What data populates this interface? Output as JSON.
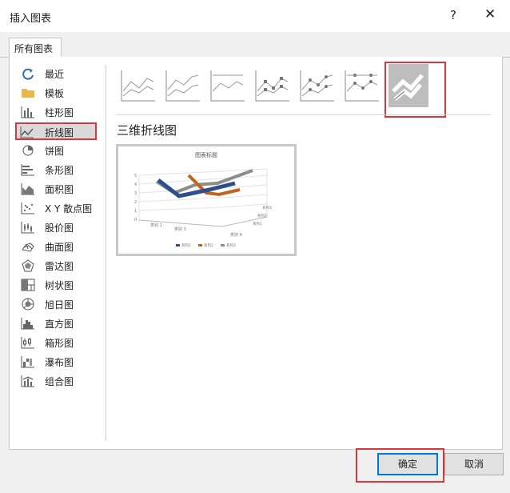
{
  "dialog": {
    "title": "插入图表",
    "help": "?",
    "close": "✕"
  },
  "tabs": [
    {
      "label": "所有图表"
    }
  ],
  "sidebar": {
    "items": [
      {
        "label": "最近",
        "icon": "recent-icon"
      },
      {
        "label": "模板",
        "icon": "folder-icon"
      },
      {
        "label": "柱形图",
        "icon": "column-chart-icon"
      },
      {
        "label": "折线图",
        "icon": "line-chart-icon",
        "selected": true
      },
      {
        "label": "饼图",
        "icon": "pie-chart-icon"
      },
      {
        "label": "条形图",
        "icon": "bar-chart-icon"
      },
      {
        "label": "面积图",
        "icon": "area-chart-icon"
      },
      {
        "label": "X Y 散点图",
        "icon": "scatter-chart-icon"
      },
      {
        "label": "股价图",
        "icon": "stock-chart-icon"
      },
      {
        "label": "曲面图",
        "icon": "surface-chart-icon"
      },
      {
        "label": "雷达图",
        "icon": "radar-chart-icon"
      },
      {
        "label": "树状图",
        "icon": "treemap-chart-icon"
      },
      {
        "label": "旭日图",
        "icon": "sunburst-chart-icon"
      },
      {
        "label": "直方图",
        "icon": "histogram-chart-icon"
      },
      {
        "label": "箱形图",
        "icon": "box-whisker-chart-icon"
      },
      {
        "label": "瀑布图",
        "icon": "waterfall-chart-icon"
      },
      {
        "label": "组合图",
        "icon": "combo-chart-icon"
      }
    ]
  },
  "subtypes": [
    {
      "icon": "line-icon"
    },
    {
      "icon": "stacked-line-icon"
    },
    {
      "icon": "100-stacked-line-icon"
    },
    {
      "icon": "line-with-markers-icon"
    },
    {
      "icon": "stacked-line-with-markers-icon"
    },
    {
      "icon": "100-stacked-line-with-markers-icon"
    },
    {
      "icon": "3d-line-icon",
      "selected": true
    }
  ],
  "section": {
    "title": "三维折线图"
  },
  "preview": {
    "title": "图表标题",
    "y_ticks": [
      "5",
      "4",
      "3",
      "2",
      "1",
      "0"
    ],
    "categories": [
      "类别 1",
      "类别 3",
      "类别 4"
    ],
    "depth_labels": [
      "系列3",
      "系列2",
      "系列1"
    ],
    "legend": [
      "系列1",
      "系列2",
      "系列3"
    ]
  },
  "colors": {
    "accent": "#0078d7",
    "highlight": "#d9383a",
    "series1": "#2e4d8a",
    "series2": "#c0631f",
    "series3": "#8c8c8c"
  },
  "buttons": {
    "ok": "确定",
    "cancel": "取消"
  }
}
